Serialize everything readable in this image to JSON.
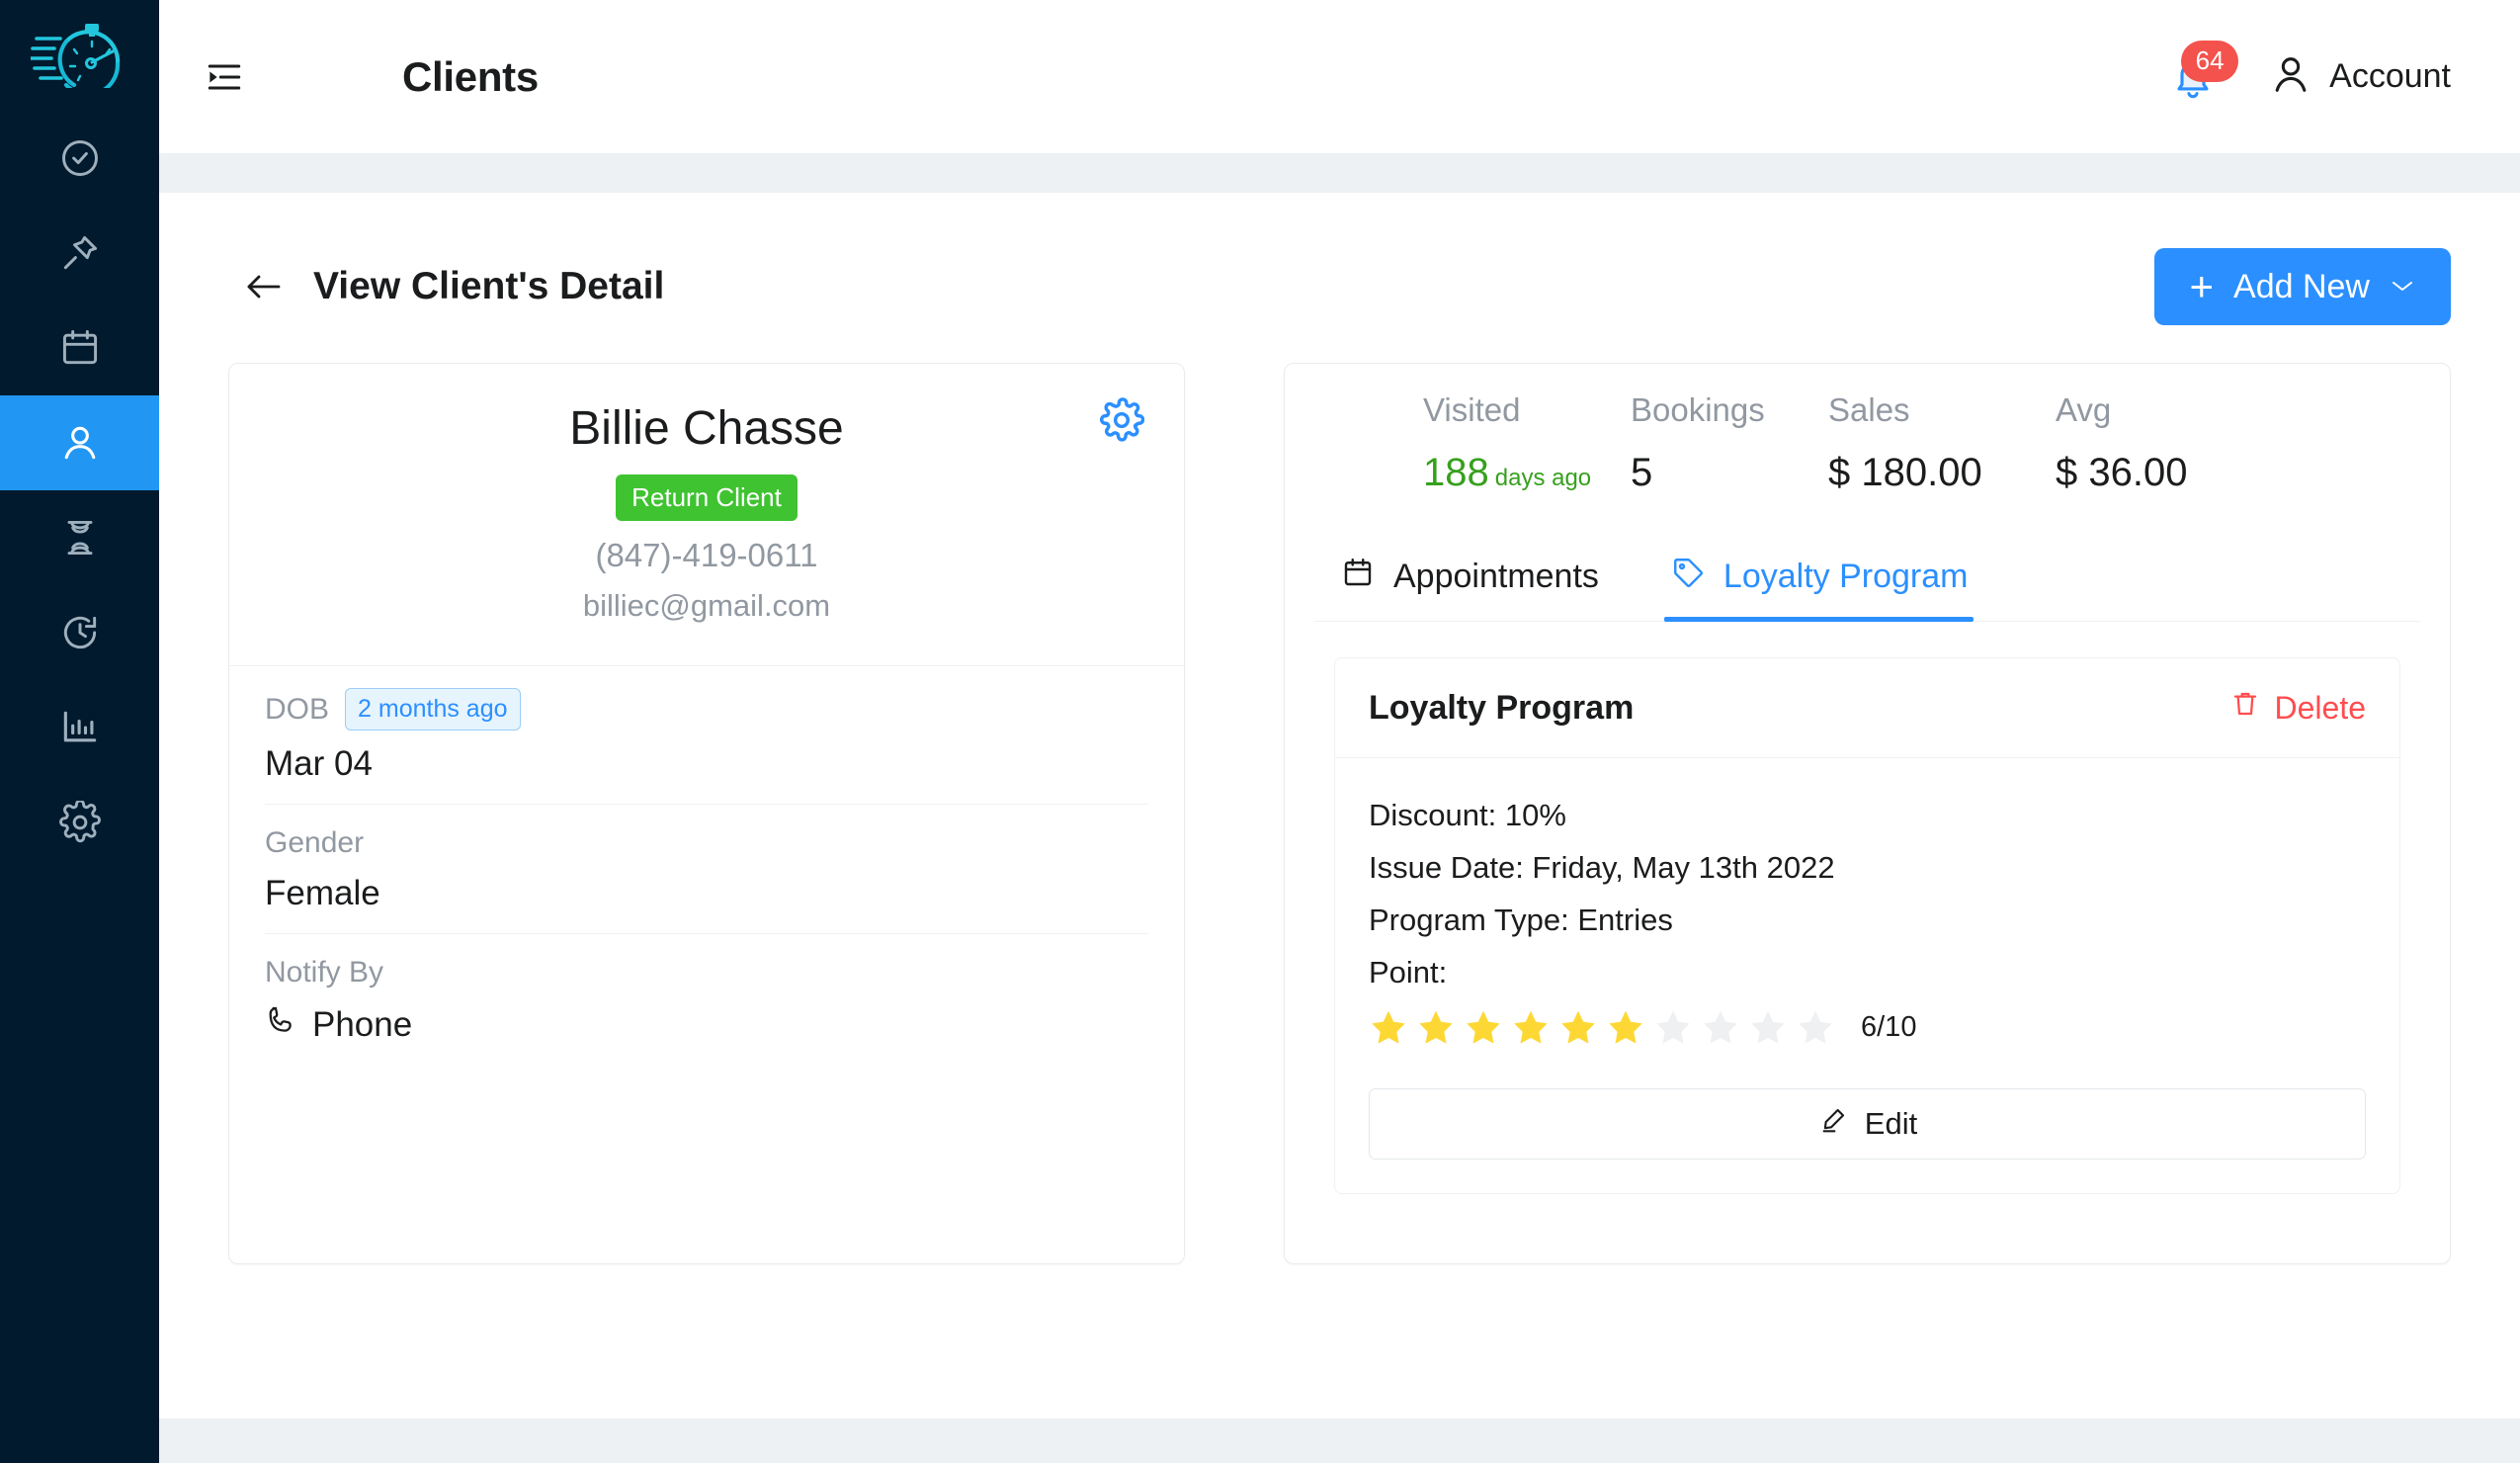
{
  "sidebar": {
    "logo_name": "stopwatch-logo",
    "items": [
      {
        "name": "tasks",
        "icon": "check-circle-icon",
        "active": false
      },
      {
        "name": "pinned",
        "icon": "pin-icon",
        "active": false
      },
      {
        "name": "calendar",
        "icon": "calendar-icon",
        "active": false
      },
      {
        "name": "clients",
        "icon": "user-icon",
        "active": true
      },
      {
        "name": "waitlist",
        "icon": "hourglass-icon",
        "active": false
      },
      {
        "name": "history",
        "icon": "clock-history-icon",
        "active": false
      },
      {
        "name": "reports",
        "icon": "bar-chart-icon",
        "active": false
      },
      {
        "name": "settings",
        "icon": "gear-icon",
        "active": false
      }
    ]
  },
  "header": {
    "menu_toggle_icon": "menu-indent-icon",
    "title": "Clients",
    "notifications": {
      "icon": "bell-icon",
      "count": "64"
    },
    "account": {
      "icon": "user-avatar-icon",
      "label": "Account"
    }
  },
  "page": {
    "back_icon": "arrow-left-icon",
    "title": "View Client's Detail",
    "add_new": {
      "plus": "+",
      "label": "Add New",
      "chevron": "⌄"
    }
  },
  "client": {
    "name": "Billie Chasse",
    "status_badge": "Return Client",
    "phone": "(847)-419-0611",
    "email": "billiec@gmail.com",
    "settings_icon": "gear-icon",
    "fields": [
      {
        "label": "DOB",
        "badge": "2 months ago",
        "value": "Mar 04",
        "icon": null
      },
      {
        "label": "Gender",
        "badge": null,
        "value": "Female",
        "icon": null
      },
      {
        "label": "Notify By",
        "badge": null,
        "value": "Phone",
        "icon": "phone-icon"
      }
    ]
  },
  "stats": [
    {
      "label": "Visited",
      "value": "188",
      "sub": "days ago",
      "color": "#37a01e"
    },
    {
      "label": "Bookings",
      "value": "5",
      "sub": "",
      "color": "#1b1c1d"
    },
    {
      "label": "Sales",
      "value": "$ 180.00",
      "sub": "",
      "color": "#1b1c1d"
    },
    {
      "label": "Avg",
      "value": "$ 36.00",
      "sub": "",
      "color": "#1b1c1d"
    }
  ],
  "tabs": [
    {
      "label": "Appointments",
      "icon": "calendar-icon",
      "active": false
    },
    {
      "label": "Loyalty Program",
      "icon": "tag-icon",
      "active": true
    }
  ],
  "loyalty": {
    "title": "Loyalty Program",
    "delete_label": "Delete",
    "delete_icon": "trash-icon",
    "discount_line": "Discount: 10%",
    "issue_date_line": "Issue Date: Friday, May 13th 2022",
    "program_type_line": "Program Type: Entries",
    "point_line": "Point:",
    "points_filled": 6,
    "points_total": 10,
    "rating_text": "6/10",
    "star_filled_color": "#fdd835",
    "star_empty_color": "#eef0f1",
    "edit_label": "Edit",
    "edit_icon": "pencil-icon"
  },
  "colors": {
    "accent": "#2b8fff",
    "sidebar_bg": "#021a2e",
    "success": "#3fc331",
    "danger": "#ff4d4f",
    "band": "#edf1f4"
  }
}
